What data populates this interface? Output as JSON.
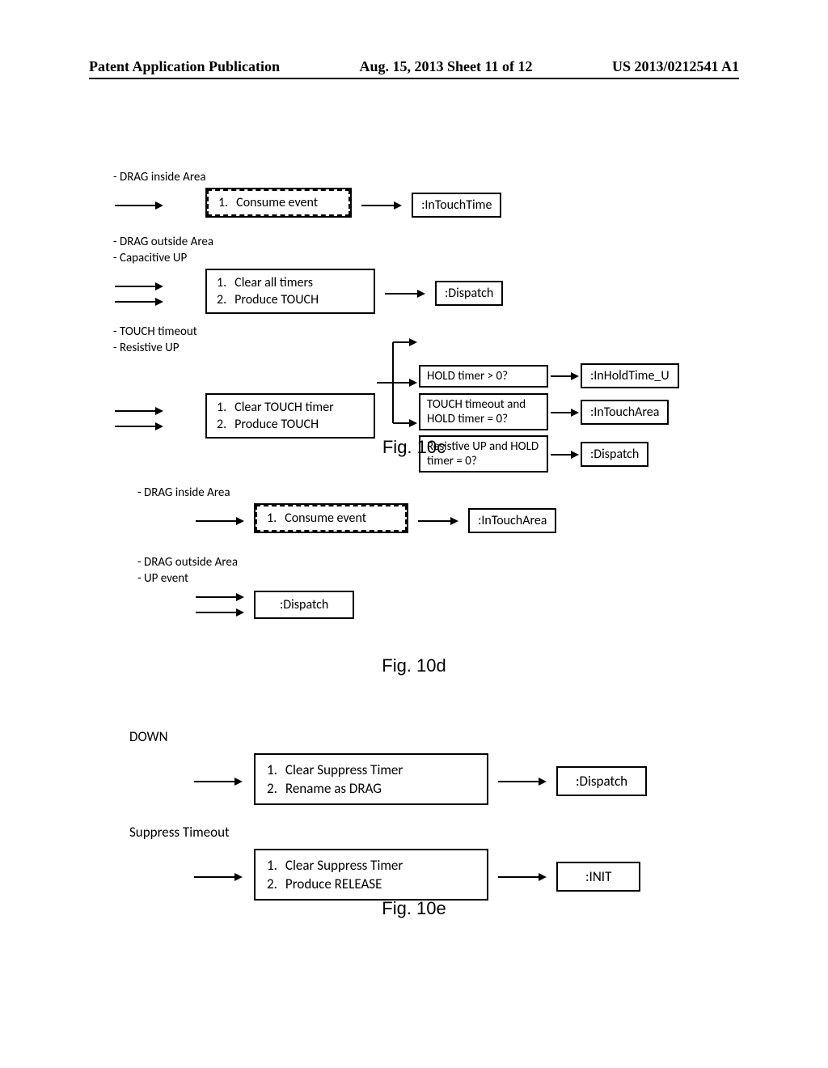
{
  "header": {
    "left": "Patent Application Publication",
    "mid": "Aug. 15, 2013  Sheet 11 of 12",
    "right": "US 2013/0212541 A1"
  },
  "figures": {
    "f10c": "Fig. 10c",
    "f10d": "Fig. 10d",
    "f10e": "Fig. 10e"
  },
  "d10c": {
    "row1": {
      "events": [
        "- DRAG inside Area"
      ],
      "proc": [
        {
          "n": "1.",
          "t": "Consume event"
        }
      ],
      "state": ":InTouchTime"
    },
    "row2": {
      "events": [
        "- DRAG outside Area",
        "- Capacitive UP"
      ],
      "proc": [
        {
          "n": "1.",
          "t": "Clear all timers"
        },
        {
          "n": "2.",
          "t": "Produce TOUCH"
        }
      ],
      "state": ":Dispatch"
    },
    "row3": {
      "events": [
        "- TOUCH timeout",
        "- Resistive UP"
      ],
      "proc": [
        {
          "n": "1.",
          "t": "Clear TOUCH timer"
        },
        {
          "n": "2.",
          "t": "Produce TOUCH"
        }
      ],
      "conds": [
        {
          "c": "HOLD timer > 0?",
          "s": ":InHoldTime_U"
        },
        {
          "c": "TOUCH timeout and HOLD timer = 0?",
          "s": ":InTouchArea"
        },
        {
          "c": "Resistive UP and HOLD timer = 0?",
          "s": ":Dispatch"
        }
      ]
    }
  },
  "d10d": {
    "row1": {
      "events": [
        "- DRAG inside Area"
      ],
      "proc": [
        {
          "n": "1.",
          "t": "Consume event"
        }
      ],
      "state": ":InTouchArea"
    },
    "row2": {
      "events": [
        "- DRAG outside Area",
        "- UP event"
      ],
      "state": ":Dispatch"
    }
  },
  "d10e": {
    "row1": {
      "events": [
        "DOWN"
      ],
      "proc": [
        {
          "n": "1.",
          "t": "Clear Suppress Timer"
        },
        {
          "n": "2.",
          "t": "Rename as DRAG"
        }
      ],
      "state": ":Dispatch"
    },
    "row2": {
      "events": [
        "Suppress Timeout"
      ],
      "proc": [
        {
          "n": "1.",
          "t": "Clear Suppress Timer"
        },
        {
          "n": "2.",
          "t": "Produce RELEASE"
        }
      ],
      "state": ":INIT"
    }
  }
}
